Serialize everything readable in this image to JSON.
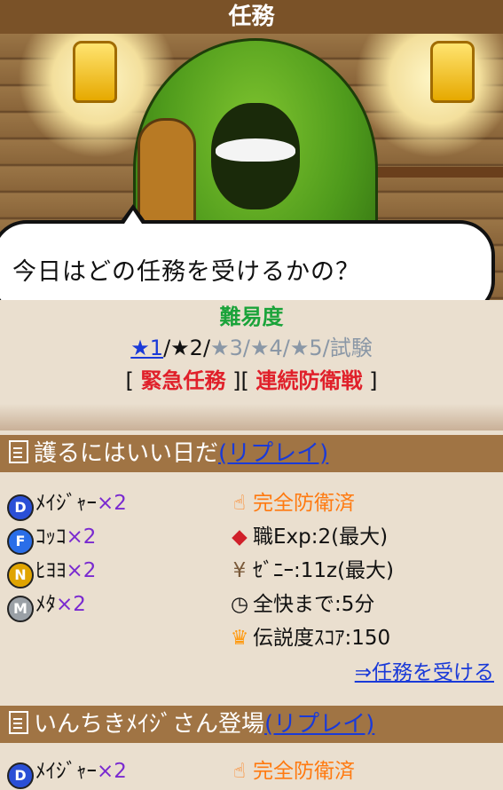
{
  "header": {
    "title": "任務"
  },
  "dialog": {
    "text": "今日はどの任務を受けるかの？"
  },
  "difficulty": {
    "title": "難易度",
    "stars": [
      "★1",
      "★2",
      "★3",
      "★4",
      "★5",
      "試験"
    ],
    "active_index": 0,
    "separator": "/",
    "links": {
      "urgent": "緊急任務",
      "continuous": "連続防衛戦",
      "open": "[",
      "close": "]"
    }
  },
  "missions": [
    {
      "title": "護るにはいい日だ",
      "replay": "(リプレイ)",
      "enemies": [
        {
          "badge": "D",
          "color": "#2a4fd6",
          "name": "ﾒｲｼﾞｬｰ",
          "count": "×2"
        },
        {
          "badge": "F",
          "color": "#2a6ee8",
          "name": "ｺｯｺ",
          "count": "×2"
        },
        {
          "badge": "N",
          "color": "#e0a400",
          "name": "ﾋﾖﾖ",
          "count": "×2"
        },
        {
          "badge": "M",
          "color": "#9aa0a6",
          "name": "ﾒﾀ",
          "count": "×2"
        }
      ],
      "status": "完全防衛済",
      "job_exp": "職Exp:2(最大)",
      "zeni": "ｾﾞﾆｰ:11z(最大)",
      "recovery": "全快まで:5分",
      "legend_score": "伝説度ｽｺｱ:150",
      "accept": "⇒任務を受ける"
    },
    {
      "title": "いんちきﾒｲｼﾞさん登場",
      "replay": "(リプレイ)",
      "enemies": [
        {
          "badge": "D",
          "color": "#2a4fd6",
          "name": "ﾒｲｼﾞｬｰ",
          "count": "×2"
        }
      ],
      "status": "完全防衛済"
    }
  ],
  "icons": {
    "status": "hand-icon",
    "job": "diamond-icon",
    "zeni": "money-bag-icon",
    "clock": "clock-icon",
    "crown": "crown-icon"
  },
  "colors": {
    "accent_blue": "#1a3ad8",
    "red": "#e0202a",
    "green": "#1aa33a",
    "orange": "#ff7a10",
    "purple": "#7a2ad0"
  }
}
